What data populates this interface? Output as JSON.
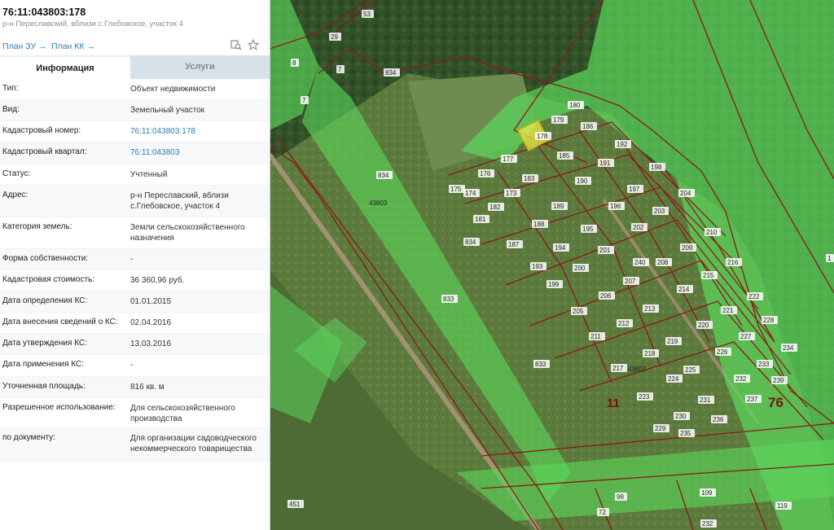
{
  "header": {
    "cadastral_number": "76:11:043803:178",
    "address": "р-н Переславский, вблизи с.Глебовское, участок 4"
  },
  "links": {
    "plan_zu": "План ЗУ →",
    "plan_kk": "План КК →"
  },
  "tabs": [
    "Информация",
    "Услуги"
  ],
  "info_rows": [
    {
      "label": "Тип:",
      "value": "Объект недвижимости",
      "link": false
    },
    {
      "label": "Вид:",
      "value": "Земельный участок",
      "link": false
    },
    {
      "label": "Кадастровый номер:",
      "value": "76:11:043803:178",
      "link": true
    },
    {
      "label": "Кадастровый квартал:",
      "value": "76:11:043803",
      "link": true
    },
    {
      "label": "Статус:",
      "value": "Учтенный",
      "link": false
    },
    {
      "label": "Адрес:",
      "value": "р-н Переславский, вблизи с.Глебовское, участок 4",
      "link": false
    },
    {
      "label": "Категория земель:",
      "value": "Земли сельскохозяйственного назначения",
      "link": false
    },
    {
      "label": "Форма собственности:",
      "value": "-",
      "link": false
    },
    {
      "label": "Кадастровая стоимость:",
      "value": "36 360,96 руб.",
      "link": false
    },
    {
      "label": "Дата определения КС:",
      "value": "01.01.2015",
      "link": false
    },
    {
      "label": "Дата внесения сведений о КС:",
      "value": "02.04.2016",
      "link": false
    },
    {
      "label": "Дата утверждения КС:",
      "value": "13.03.2016",
      "link": false
    },
    {
      "label": "Дата применения КС:",
      "value": "-",
      "link": false
    },
    {
      "label": "Уточненная площадь:",
      "value": "816 кв. м",
      "link": false
    },
    {
      "label": "Разрешенное использование:",
      "value": "Для сельскохозяйственного производства",
      "link": false
    },
    {
      "label": "по документу:",
      "value": "Для организации садоводческого некоммерческого товарищества",
      "link": false
    }
  ],
  "map": {
    "quarter_label": "43803",
    "district_labels": [
      "11",
      "76"
    ],
    "selected_parcel": "178",
    "parcel_labels": [
      "53",
      "29",
      "8",
      "7",
      "7",
      "834",
      "834",
      "834",
      "833",
      "833",
      "451",
      "180",
      "179",
      "186",
      "178",
      "192",
      "177",
      "176",
      "175",
      "174",
      "173",
      "183",
      "182",
      "181",
      "185",
      "191",
      "190",
      "198",
      "197",
      "204",
      "196",
      "189",
      "188",
      "187",
      "195",
      "203",
      "202",
      "210",
      "201",
      "194",
      "193",
      "200",
      "209",
      "208",
      "199",
      "216",
      "215",
      "214",
      "207",
      "206",
      "205",
      "240",
      "222",
      "221",
      "220",
      "213",
      "212",
      "211",
      "228",
      "227",
      "219",
      "226",
      "218",
      "217",
      "234",
      "233",
      "225",
      "224",
      "232",
      "223",
      "231",
      "237",
      "239",
      "230",
      "229",
      "236",
      "235",
      "98",
      "72",
      "109",
      "232",
      "119",
      "1"
    ]
  }
}
